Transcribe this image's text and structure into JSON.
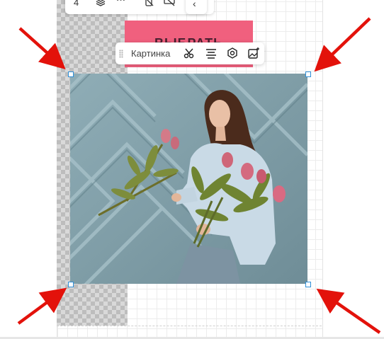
{
  "top_toolbar": {
    "page_number": "4"
  },
  "context_toolbar": {
    "label": "Картинка"
  },
  "pink_block": {
    "text": "ВЫБРАТЬ"
  },
  "colors": {
    "accent": "#f0607e",
    "handle_border": "#2f8fd8",
    "arrow": "#e3120b"
  },
  "icons": [
    "layers-icon",
    "more-icon",
    "no-mobile-icon",
    "hide-icon",
    "back-icon",
    "scissors-icon",
    "align-icon",
    "settings-icon",
    "image-edit-icon"
  ]
}
